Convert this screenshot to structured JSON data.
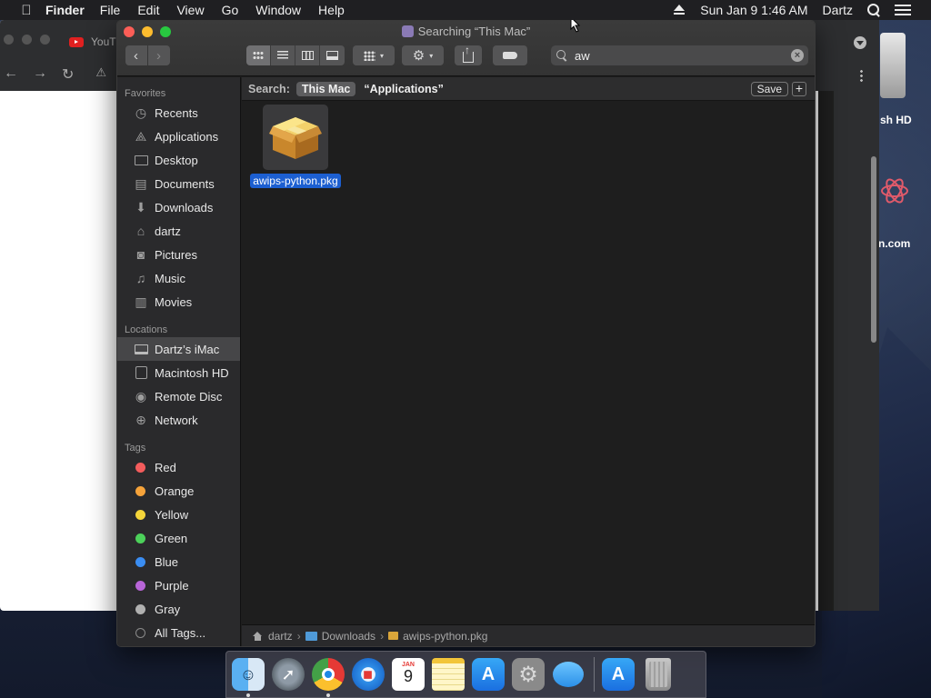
{
  "menubar": {
    "app_name": "Finder",
    "menus": [
      "File",
      "Edit",
      "View",
      "Go",
      "Window",
      "Help"
    ],
    "clock": "Sun Jan 9  1:46 AM",
    "user": "Dartz"
  },
  "browser": {
    "tab_title": "YouT"
  },
  "desktop": {
    "drive_label": "sh HD",
    "site_label": "n.com"
  },
  "finder": {
    "title": "Searching “This Mac”",
    "search": {
      "value": "aw"
    },
    "scope": {
      "label": "Search:",
      "active": "This Mac",
      "other": "“Applications”",
      "save_label": "Save",
      "add_label": "+"
    },
    "sidebar": {
      "favorites_header": "Favorites",
      "favorites": [
        {
          "label": "Recents",
          "icon": "clock-icon"
        },
        {
          "label": "Applications",
          "icon": "applications-icon"
        },
        {
          "label": "Desktop",
          "icon": "desktop-icon"
        },
        {
          "label": "Documents",
          "icon": "document-icon"
        },
        {
          "label": "Downloads",
          "icon": "download-icon"
        },
        {
          "label": "dartz",
          "icon": "home-icon"
        },
        {
          "label": "Pictures",
          "icon": "camera-icon"
        },
        {
          "label": "Music",
          "icon": "music-icon"
        },
        {
          "label": "Movies",
          "icon": "film-icon"
        }
      ],
      "locations_header": "Locations",
      "locations": [
        {
          "label": "Dartz’s iMac",
          "icon": "imac-icon"
        },
        {
          "label": "Macintosh HD",
          "icon": "hard-drive-icon"
        },
        {
          "label": "Remote Disc",
          "icon": "disc-icon"
        },
        {
          "label": "Network",
          "icon": "globe-icon"
        }
      ],
      "tags_header": "Tags",
      "tags": [
        {
          "label": "Red",
          "color": "#f35c5c"
        },
        {
          "label": "Orange",
          "color": "#f6a33a"
        },
        {
          "label": "Yellow",
          "color": "#f4d53a"
        },
        {
          "label": "Green",
          "color": "#4cd15a"
        },
        {
          "label": "Blue",
          "color": "#3a8df2"
        },
        {
          "label": "Purple",
          "color": "#b865d8"
        },
        {
          "label": "Gray",
          "color": "#b0b0b0"
        },
        {
          "label": "All Tags...",
          "color": ""
        }
      ]
    },
    "files": [
      {
        "name": "awips-python.pkg",
        "icon": "package-icon"
      }
    ],
    "path": [
      "dartz",
      "Downloads",
      "awips-python.pkg"
    ]
  },
  "dock": {
    "apps": [
      "Finder",
      "Launchpad",
      "Chrome",
      "Safari",
      "Calendar",
      "Notes",
      "App Store",
      "System Preferences",
      "Messages",
      "App Store",
      "Trash"
    ],
    "calendar_month": "JAN",
    "calendar_day": "9"
  },
  "colors": {
    "selection": "#1c5fd1",
    "window_bg": "#1e1e1e",
    "sidebar_bg": "#2a2a2c"
  }
}
